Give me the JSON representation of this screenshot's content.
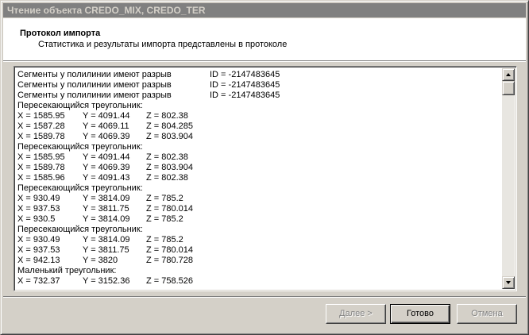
{
  "window": {
    "title": "Чтение объекта CREDO_MIX, CREDO_TER"
  },
  "header": {
    "title": "Протокол импорта",
    "subtitle": "Статистика и результаты импорта представлены в протоколе"
  },
  "log": {
    "lines": [
      {
        "type": "segment",
        "text": "Сегменты у полилинии имеют разрыв",
        "id": "ID = -2147483645"
      },
      {
        "type": "segment",
        "text": "Сегменты у полилинии имеют разрыв",
        "id": "ID = -2147483645"
      },
      {
        "type": "segment",
        "text": "Сегменты у полилинии имеют разрыв",
        "id": "ID = -2147483645"
      },
      {
        "type": "label",
        "text": "Пересекающийся треугольник:"
      },
      {
        "type": "coords",
        "x": "X = 1585.95",
        "y": "Y = 4091.44",
        "z": "Z = 802.38"
      },
      {
        "type": "coords",
        "x": "X = 1587.28",
        "y": "Y = 4069.11",
        "z": "Z = 804.285"
      },
      {
        "type": "coords",
        "x": "X = 1589.78",
        "y": "Y = 4069.39",
        "z": "Z = 803.904"
      },
      {
        "type": "label",
        "text": "Пересекающийся треугольник:"
      },
      {
        "type": "coords",
        "x": "X = 1585.95",
        "y": "Y = 4091.44",
        "z": "Z = 802.38"
      },
      {
        "type": "coords",
        "x": "X = 1589.78",
        "y": "Y = 4069.39",
        "z": "Z = 803.904"
      },
      {
        "type": "coords",
        "x": "X = 1585.96",
        "y": "Y = 4091.43",
        "z": "Z = 802.38"
      },
      {
        "type": "label",
        "text": "Пересекающийся треугольник:"
      },
      {
        "type": "coords",
        "x": "X = 930.49",
        "y": "Y = 3814.09",
        "z": "Z = 785.2"
      },
      {
        "type": "coords",
        "x": "X = 937.53",
        "y": "Y = 3811.75",
        "z": "Z = 780.014"
      },
      {
        "type": "coords",
        "x": "X = 930.5",
        "y": "Y = 3814.09",
        "z": "Z = 785.2"
      },
      {
        "type": "label",
        "text": "Пересекающийся треугольник:"
      },
      {
        "type": "coords",
        "x": "X = 930.49",
        "y": "Y = 3814.09",
        "z": "Z = 785.2"
      },
      {
        "type": "coords",
        "x": "X = 937.53",
        "y": "Y = 3811.75",
        "z": "Z = 780.014"
      },
      {
        "type": "coords",
        "x": "X = 942.13",
        "y": "Y = 3820",
        "z": "Z = 780.728"
      },
      {
        "type": "label",
        "text": "Маленький треугольник:"
      },
      {
        "type": "coords",
        "x": "X = 732.37",
        "y": "Y = 3152.36",
        "z": "Z = 758.526"
      }
    ]
  },
  "buttons": {
    "next_label": "Далее >",
    "done_label": "Готово",
    "cancel_label": "Отмена"
  },
  "icons": {
    "scroll_up": "arrow-up-icon",
    "scroll_down": "arrow-down-icon"
  }
}
